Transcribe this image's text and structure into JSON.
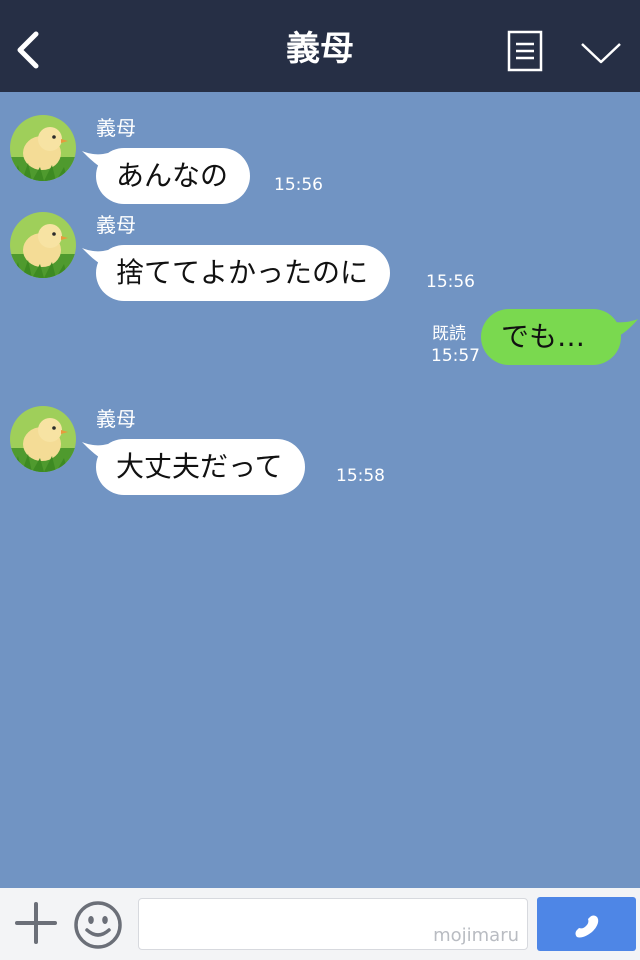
{
  "header": {
    "title": "義母",
    "back_icon": "chevron-left-icon",
    "notes_icon": "notes-icon",
    "more_icon": "chevron-down-icon",
    "background": "#262f45"
  },
  "chat": {
    "background": "#7194c3",
    "messages": [
      {
        "direction": "in",
        "sender": "義母",
        "text": "あんなの",
        "time": "15:56"
      },
      {
        "direction": "in",
        "sender": "義母",
        "text": "捨ててよかったのに",
        "time": "15:56"
      },
      {
        "direction": "out",
        "text": "でも…",
        "read": "既読",
        "time": "15:57"
      },
      {
        "direction": "in",
        "sender": "義母",
        "text": "大丈夫だって",
        "time": "15:58"
      }
    ],
    "incoming_bubble_color": "#ffffff",
    "outgoing_bubble_color": "#7ad94f"
  },
  "input_bar": {
    "plus_icon": "plus-icon",
    "emoji_icon": "smiley-icon",
    "field_value": "",
    "watermark": "mojimaru",
    "call_icon": "phone-icon",
    "call_button_color": "#4e86e6"
  }
}
